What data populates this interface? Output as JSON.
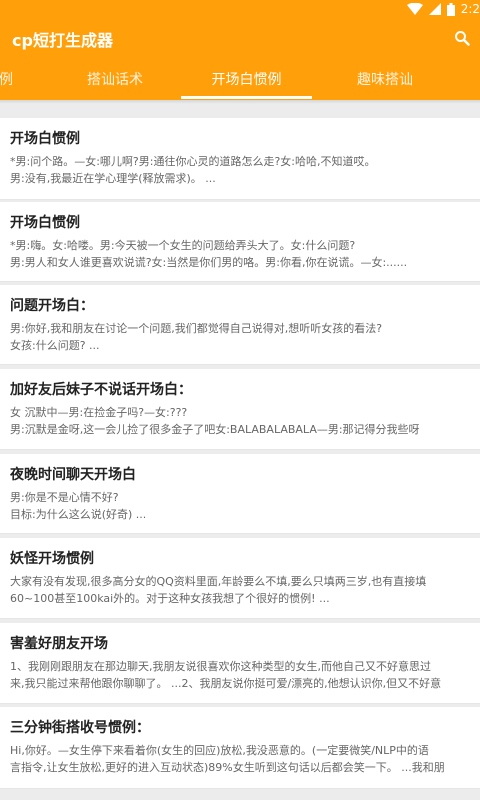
{
  "status": {
    "time": "2:2"
  },
  "app": {
    "title": "cp短打生成器"
  },
  "tabs": [
    {
      "label": "例",
      "active": false
    },
    {
      "label": "搭讪话术",
      "active": false
    },
    {
      "label": "开场白惯例",
      "active": true
    },
    {
      "label": "趣味搭讪",
      "active": false
    }
  ],
  "cards": [
    {
      "title": "开场白惯例",
      "lines": [
        "*男:问个路。—女:哪儿啊?男:通往你心灵的道路怎么走?女:哈哈,不知道哎。",
        "男:没有,我最近在学心理学(释放需求)。 ..."
      ]
    },
    {
      "title": "开场白惯例",
      "lines": [
        "*男:嗨。女:哈喽。男:今天被一个女生的问题给弄头大了。女:什么问题?",
        "男:男人和女人谁更喜欢说谎?女:当然是你们男的咯。男:你看,你在说谎。—女:......"
      ]
    },
    {
      "title": "问题开场白：",
      "lines": [
        "男:你好,我和朋友在讨论一个问题,我们都觉得自己说得对,想听听女孩的看法?",
        "女孩:什么问题? ..."
      ]
    },
    {
      "title": "加好友后妹子不说话开场白：",
      "lines": [
        "女 沉默中—男:在捡金子吗?—女:???",
        "男:沉默是金呀,这一会儿捡了很多金子了吧女:BALABALABALA—男:那记得分我些呀"
      ]
    },
    {
      "title": "夜晚时间聊天开场白",
      "lines": [
        "男:你是不是心情不好?",
        "目标:为什么这么说(好奇) ..."
      ]
    },
    {
      "title": "妖怪开场惯例",
      "lines": [
        "大家有没有发现,很多高分女的QQ资料里面,年龄要么不填,要么只填两三岁,也有直接填",
        "60~100甚至100kai外的。对于这种女孩我想了个很好的惯例! ..."
      ]
    },
    {
      "title": "害羞好朋友开场",
      "lines": [
        "1、我刚刚跟朋友在那边聊天,我朋友说很喜欢你这种类型的女生,而他自己又不好意思过",
        "来,我只能过来帮他跟你聊聊了。 ...2、我朋友说你挺可爱/漂亮的,他想认识你,但又不好意"
      ]
    },
    {
      "title": "三分钟街搭收号惯例：",
      "lines": [
        "Hi,你好。—女生停下来看着你(女生的回应)放松,我没恶意的。(一定要微笑/NLP中的语",
        "言指令,让女生放松,更好的进入互动状态)89%女生听到这句话以后都会笑一下。 ...我和朋"
      ]
    }
  ]
}
